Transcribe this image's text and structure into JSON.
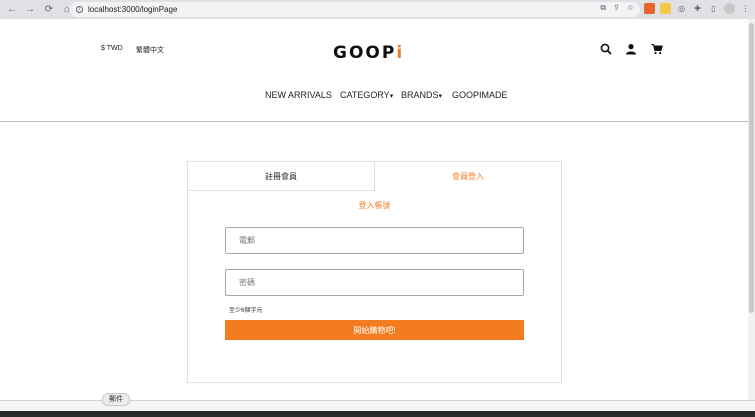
{
  "browser": {
    "url": "localhost:3000/loginPage",
    "back_glyph": "←",
    "forward_glyph": "→",
    "reload_glyph": "⟳",
    "home_glyph": "⌂"
  },
  "header": {
    "currency": "$ TWD",
    "language": "繁體中文",
    "logo_text": "GOOP",
    "logo_suffix": "i",
    "nav": [
      "NEW ARRIVALS",
      "CATEGORY",
      "BRANDS",
      "GOOPIMADE"
    ],
    "dropdown_mark": "▾"
  },
  "login": {
    "tab_register": "註冊會員",
    "tab_login": "會員登入",
    "title": "登入帳號",
    "email_placeholder": "電郵",
    "password_placeholder": "密碼",
    "password_hint": "至少6個字元",
    "submit_label": "開始購物吧!"
  },
  "bottom": {
    "mail_label": "郵件"
  },
  "colors": {
    "accent": "#f47c20",
    "border": "#e0e0e0"
  }
}
